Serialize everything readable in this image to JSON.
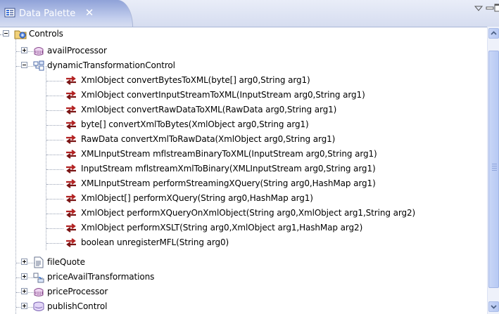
{
  "view": {
    "title": "Data Palette",
    "close_glyph": "✕",
    "icons": {
      "view_icon": "data-palette-icon",
      "view_menu": "chevron-down-icon",
      "minimize": "minimize-icon",
      "maximize": "maximize-icon"
    }
  },
  "tree": {
    "root": {
      "label": "Controls",
      "icon": "controls-folder-icon"
    },
    "avail_processor": {
      "label": "availProcessor",
      "icon": "processor-control-icon"
    },
    "dynamic_control": {
      "label": "dynamicTransformationControl",
      "icon": "transformation-control-icon"
    },
    "methods": [
      {
        "label": "XmlObject convertBytesToXML(byte[] arg0,String arg1)"
      },
      {
        "label": "XmlObject convertInputStreamToXML(InputStream arg0,String arg1)"
      },
      {
        "label": "XmlObject convertRawDataToXML(RawData arg0,String arg1)"
      },
      {
        "label": "byte[] convertXmlToBytes(XmlObject arg0,String arg1)"
      },
      {
        "label": "RawData convertXmlToRawData(XmlObject arg0,String arg1)"
      },
      {
        "label": "XMLInputStream mflstreamBinaryToXML(InputStream arg0,String arg1)"
      },
      {
        "label": "InputStream mflstreamXmlToBinary(XMLInputStream arg0,String arg1)"
      },
      {
        "label": "XMLInputStream performStreamingXQuery(String arg0,HashMap arg1)"
      },
      {
        "label": "XmlObject[] performXQuery(String arg0,HashMap arg1)"
      },
      {
        "label": "XmlObject performXQueryOnXmlObject(String arg0,XmlObject arg1,String arg2)"
      },
      {
        "label": "XmlObject performXSLT(String arg0,XmlObject arg1,HashMap arg2)"
      },
      {
        "label": "boolean unregisterMFL(String arg0)"
      }
    ],
    "method_icon": "transform-method-icon",
    "file_quote": {
      "label": "fileQuote",
      "icon": "file-control-icon"
    },
    "price_avail": {
      "label": "priceAvailTransformations",
      "icon": "transformations-icon"
    },
    "price_processor": {
      "label": "priceProcessor",
      "icon": "processor-control-icon"
    },
    "publish_control": {
      "label": "publishControl",
      "icon": "publish-control-icon"
    }
  },
  "colors": {
    "title_gradient_dark": "#8fa2d8",
    "title_gradient_light": "#d6ddf0",
    "method_icon_red": "#b22222",
    "scrollbar": "#b7c9f4"
  }
}
